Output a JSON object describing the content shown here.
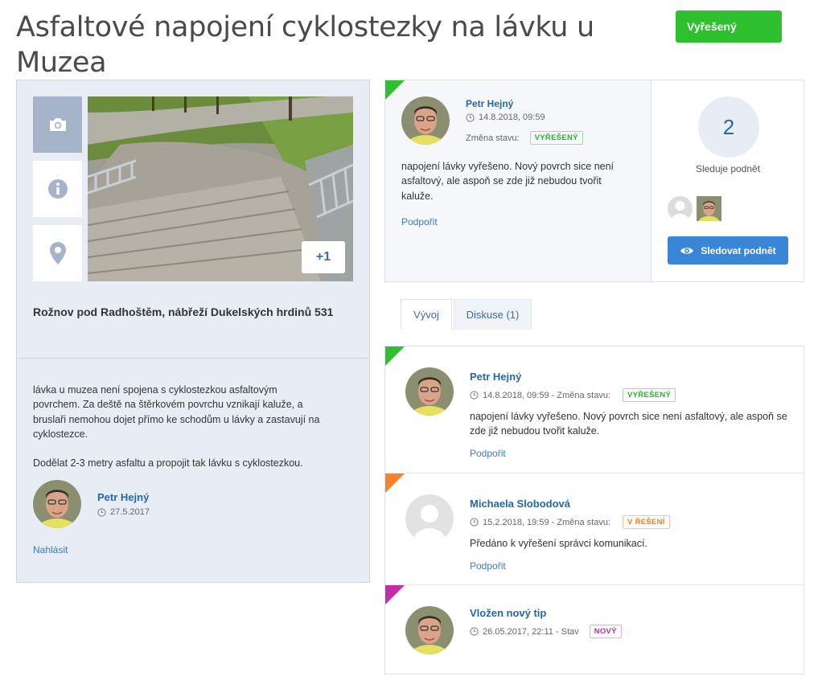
{
  "title": "Asfaltové napojení cyklostezky na lávku u Muzea",
  "status_button": "Vyřešený",
  "left_panel": {
    "tabs": [
      {
        "icon": "camera-icon"
      },
      {
        "icon": "info-icon"
      },
      {
        "icon": "map-pin-icon"
      }
    ],
    "photo_more": "+1",
    "address": "Rožnov pod Radhoštěm, nábřeží Dukelských hrdinů 531",
    "description": [
      "lávka u muzea není spojena s cyklostezkou asfaltovým povrchem. Za deště na štěrkovém povrchu vznikají kaluže, a bruslaři nemohou dojet přímo ke schodům u lávky a zastavují na cyklostezce.",
      "Dodělat 2-3 metry asfaltu a propojit tak lávku s cyklostezkou."
    ],
    "author": {
      "name": "Petr Hejný",
      "date": "27.5.2017"
    },
    "report_link": "Nahlásit"
  },
  "latest": {
    "author": "Petr Hejný",
    "date": "14.8.2018, 09:59",
    "change_label": "Změna stavu:",
    "status": "VYŘEŠENÝ",
    "text": "napojení lávky vyřešeno. Nový povrch sice není asfaltový, ale aspoň se zde již nebudou tvořit kaluže.",
    "support": "Podpořit"
  },
  "followers": {
    "count": "2",
    "label": "Sleduje podnět",
    "button": "Sledovat podnět"
  },
  "tabs": {
    "development": "Vývoj",
    "discussion": "Diskuse (1)"
  },
  "timeline": [
    {
      "author": "Petr Hejný",
      "meta": "14.8.2018, 09:59 - Změna stavu:",
      "status": "VYŘEŠENÝ",
      "status_color": "#2ec02e",
      "text": "napojení lávky vyřešeno. Nový povrch sice není asfaltový, ale aspoň se zde již nebudou tvořit kaluže.",
      "support": "Podpořit"
    },
    {
      "author": "Michaela Slobodová",
      "meta": "15.2.2018, 19:59 - Změna stavu:",
      "status": "V ŘEŠENÍ",
      "status_color": "#f07c24",
      "text": "Předáno k vyřešení správci komunikací.",
      "support": "Podpořit"
    },
    {
      "author": "Vložen nový tip",
      "meta": "26.05.2017, 22:11 - Stav",
      "status": "NOVÝ",
      "status_color": "#c62ba8"
    }
  ]
}
